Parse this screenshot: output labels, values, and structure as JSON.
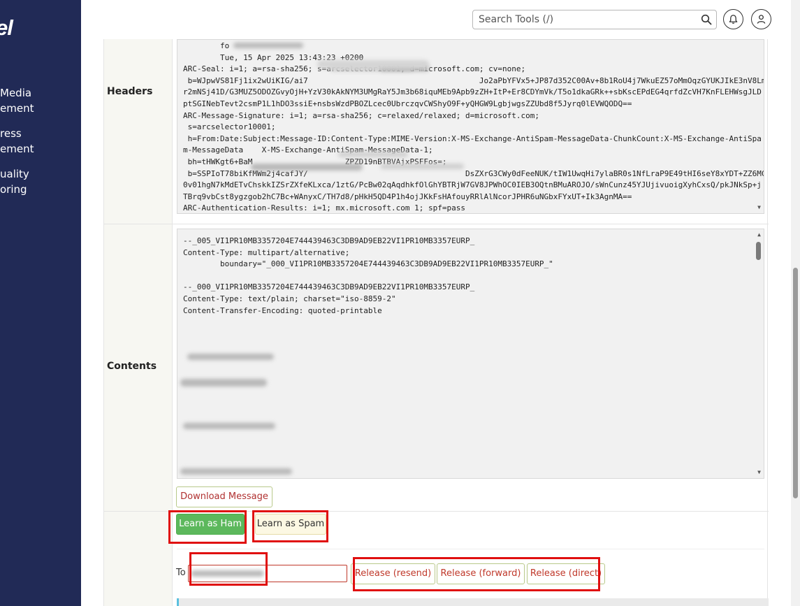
{
  "sidebar": {
    "logo_text": "el",
    "items": [
      {
        "line1": "Media",
        "line2": "ement"
      },
      {
        "line1": "ress",
        "line2": "ement"
      },
      {
        "line1": "uality",
        "line2": "oring"
      }
    ]
  },
  "topbar": {
    "search_placeholder": "Search Tools (/)",
    "search_icon": "search-icon",
    "bell_icon": "bell-icon",
    "user_icon": "user-icon"
  },
  "headers": {
    "label": "Headers",
    "lines": [
      "        fo",
      "        Tue, 15 Apr 2025 13:43:23 +0200",
      "ARC-Seal: i=1; a=rsa-sha256; s=arcselector10001; d=microsoft.com; cv=none;",
      " b=WJpwVS81Fj1ix2wUiKIG/ai7                                     Jo2aPbYFVx5+JP87d352C00Av+8b1RoU4j7WkuEZ57oMmOqzGYUKJIkE3nV8Lm+MU6fFP",
      "r2mNSj41D/G3MUZ5ODOZGvyOjH+YzV30kAkNYM3UMgRaY5Jm3b68iquMEb9Apb9zZH+ItP+Er8CDYmVk/T5o1dkaGRk++sbKscEPdEG4qrfdZcVH7KnFLEHWsgJLD",
      "ptSGINebTevt2csmP1L1hDO3ssiE+nsbsWzdPBOZLcec0UbrczqvCWShyO9F+yQHGW9LgbjwgsZZUbd8f5Jyrq0lEVWQODQ==",
      "ARC-Message-Signature: i=1; a=rsa-sha256; c=relaxed/relaxed; d=microsoft.com;",
      " s=arcselector10001;",
      " h=From:Date:Subject:Message-ID:Content-Type:MIME-Version:X-MS-Exchange-AntiSpam-MessageData-ChunkCount:X-MS-Exchange-AntiSpa",
      "m-MessageData    X-MS-Exchange-AntiSpam-MessageData-1;",
      " bh=tHWKgt6+BaM                    ZPZD19nBTBVAjxPSFFos=;",
      " b=SSPIoT78biKfMWm2j4cafJY/                                  DsZXrG3CWy0dFeeNUK/tIW1UwqHi7ylaBR0s1NfLraP9E49tHI6seY8xYDT+ZZ6MCXbWBXYf1w",
      "0v01hgN7kMdETvChskkIZSrZXfeKLxca/1ztG/PcBw02qAqdhkfOlGhYBTRjW7GV8JPWhOC0IEB3OQtnBMuAROJO/sWnCunz45YJUjivuoigXyhCxsQ/pkJNkSp+j",
      "TBrq9vbCst8ygzgob2hC7Bc+WAnyxC/TH7d8/pHkH5QD4P1h4ojJKkFsHAfouyRRlAlNcorJPHR6uNGbxFYxUT+Ik3AgnMA==",
      "ARC-Authentication-Results: i=1; mx.microsoft.com 1; spf=pass"
    ]
  },
  "contents": {
    "label": "Contents",
    "lines": [
      "--_005_VI1PR10MB3357204E744439463C3DB9AD9EB22VI1PR10MB3357EURP_",
      "Content-Type: multipart/alternative;",
      "        boundary=\"_000_VI1PR10MB3357204E744439463C3DB9AD9EB22VI1PR10MB3357EURP_\"",
      "",
      "--_000_VI1PR10MB3357204E744439463C3DB9AD9EB22VI1PR10MB3357EURP_",
      "Content-Type: text/plain; charset=\"iso-8859-2\"",
      "Content-Transfer-Encoding: quoted-printable"
    ]
  },
  "actions": {
    "download_label": "Download Message",
    "ham_label": "Learn as Ham",
    "spam_label": "Learn as Spam",
    "to_label": "To",
    "release_resend": "Release (resend)",
    "release_forward": "Release (forward)",
    "release_direct": "Release (direct)"
  },
  "colors": {
    "sidebar_bg": "#212a56",
    "ham_bg": "#5cb85c",
    "spam_bg": "#fcf8e3",
    "annotation_red": "#e01010"
  }
}
